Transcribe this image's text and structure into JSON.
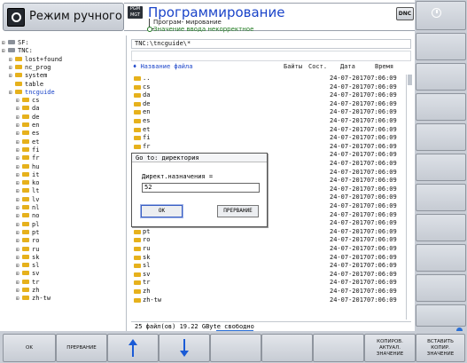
{
  "header": {
    "mode_title": "Режим ручного упра...",
    "program_title": "Программирование",
    "pgm_icon": "PGM MGT",
    "subtitle": "Програм- мирование",
    "status_line": "Значение ввода некорректное",
    "dnc": "DNC"
  },
  "tree": [
    {
      "label": "SF:",
      "level": 0,
      "drive": true
    },
    {
      "label": "TNC:",
      "level": 0,
      "drive": true
    },
    {
      "label": "lost+found",
      "level": 1
    },
    {
      "label": "nc_prog",
      "level": 1
    },
    {
      "label": "system",
      "level": 1
    },
    {
      "label": "table",
      "level": 1,
      "noexp": true
    },
    {
      "label": "tncguide",
      "level": 1,
      "selected": true
    },
    {
      "label": "cs",
      "level": 2
    },
    {
      "label": "da",
      "level": 2
    },
    {
      "label": "de",
      "level": 2
    },
    {
      "label": "en",
      "level": 2
    },
    {
      "label": "es",
      "level": 2
    },
    {
      "label": "et",
      "level": 2
    },
    {
      "label": "fi",
      "level": 2
    },
    {
      "label": "fr",
      "level": 2
    },
    {
      "label": "hu",
      "level": 2
    },
    {
      "label": "it",
      "level": 2
    },
    {
      "label": "ko",
      "level": 2
    },
    {
      "label": "lt",
      "level": 2
    },
    {
      "label": "lv",
      "level": 2
    },
    {
      "label": "nl",
      "level": 2
    },
    {
      "label": "no",
      "level": 2
    },
    {
      "label": "pl",
      "level": 2
    },
    {
      "label": "pt",
      "level": 2
    },
    {
      "label": "ro",
      "level": 2
    },
    {
      "label": "ru",
      "level": 2
    },
    {
      "label": "sk",
      "level": 2
    },
    {
      "label": "sl",
      "level": 2
    },
    {
      "label": "sv",
      "level": 2
    },
    {
      "label": "tr",
      "level": 2
    },
    {
      "label": "zh",
      "level": 2
    },
    {
      "label": "zh-tw",
      "level": 2
    }
  ],
  "path": "TNC:\\tncguide\\*",
  "columns": {
    "name": "Название файла",
    "bytes": "Байты",
    "status": "Сост.",
    "date": "Дата",
    "time": "Время"
  },
  "files": [
    {
      "name": "..",
      "date": "24-07-2017",
      "time": "07:06:09"
    },
    {
      "name": "cs",
      "date": "24-07-2017",
      "time": "07:06:09"
    },
    {
      "name": "da",
      "date": "24-07-2017",
      "time": "07:06:09"
    },
    {
      "name": "de",
      "date": "24-07-2017",
      "time": "07:06:09"
    },
    {
      "name": "en",
      "date": "24-07-2017",
      "time": "07:06:09"
    },
    {
      "name": "es",
      "date": "24-07-2017",
      "time": "07:06:09"
    },
    {
      "name": "et",
      "date": "24-07-2017",
      "time": "07:06:09"
    },
    {
      "name": "fi",
      "date": "24-07-2017",
      "time": "07:06:09"
    },
    {
      "name": "fr",
      "date": "24-07-2017",
      "time": "07:06:09"
    },
    {
      "name": "",
      "date": "24-07-2017",
      "time": "07:06:09"
    },
    {
      "name": "",
      "date": "24-07-2017",
      "time": "07:06:09"
    },
    {
      "name": "",
      "date": "24-07-2017",
      "time": "07:06:09"
    },
    {
      "name": "",
      "date": "24-07-2017",
      "time": "07:06:09"
    },
    {
      "name": "",
      "date": "24-07-2017",
      "time": "07:06:09"
    },
    {
      "name": "",
      "date": "24-07-2017",
      "time": "07:06:09"
    },
    {
      "name": "",
      "date": "24-07-2017",
      "time": "07:06:09"
    },
    {
      "name": "",
      "date": "24-07-2017",
      "time": "07:06:09"
    },
    {
      "name": "",
      "date": "24-07-2017",
      "time": "07:06:09"
    },
    {
      "name": "pt",
      "date": "24-07-2017",
      "time": "07:06:09"
    },
    {
      "name": "ro",
      "date": "24-07-2017",
      "time": "07:06:09"
    },
    {
      "name": "ru",
      "date": "24-07-2017",
      "time": "07:06:09"
    },
    {
      "name": "sk",
      "date": "24-07-2017",
      "time": "07:06:09"
    },
    {
      "name": "sl",
      "date": "24-07-2017",
      "time": "07:06:09"
    },
    {
      "name": "sv",
      "date": "24-07-2017",
      "time": "07:06:09"
    },
    {
      "name": "tr",
      "date": "24-07-2017",
      "time": "07:06:09"
    },
    {
      "name": "zh",
      "date": "24-07-2017",
      "time": "07:06:09"
    },
    {
      "name": "zh-tw",
      "date": "24-07-2017",
      "time": "07:06:09"
    }
  ],
  "status": "25  файл(ов)  19.22 GByte свободно",
  "dialog": {
    "title": "Go to: директория",
    "label": "Директ.назначения =",
    "value": "52",
    "ok": "OK",
    "cancel": "ПРЕРВАНИЕ"
  },
  "softkeys": {
    "ok": "OK",
    "cancel": "ПРЕРВАНИЕ",
    "copy_actual": [
      "КОПИРОВ.",
      "АКТУАЛ.",
      "ЗНАЧЕНИЕ"
    ],
    "paste": [
      "ВСТАВИТЬ",
      "КОПИР.",
      "ЗНАЧЕНИЕ"
    ]
  },
  "colors": {
    "accent": "#1a44c9",
    "folder": "#e6b11c",
    "panel": "#c9ced6",
    "ok_text": "#1f7a1f"
  }
}
